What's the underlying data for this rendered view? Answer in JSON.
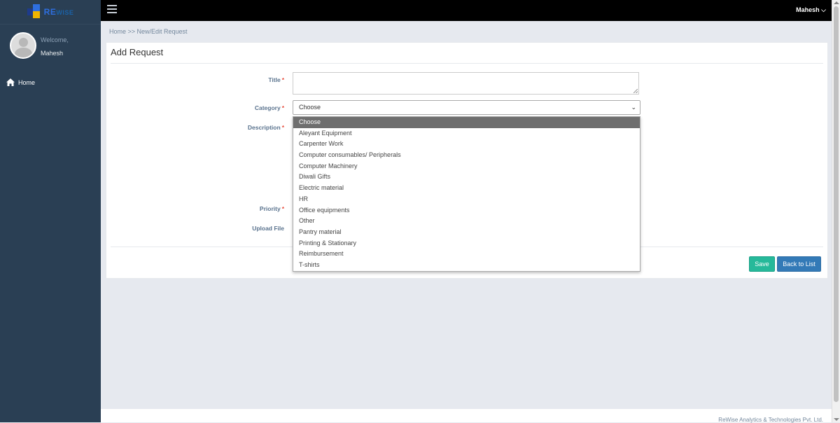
{
  "app": {
    "logo_text": "RE",
    "logo_suffix": "WISE"
  },
  "sidebar": {
    "welcome_label": "Welcome,",
    "user_name": "Mahesh",
    "nav": [
      {
        "label": "Home",
        "icon": "home-icon"
      }
    ]
  },
  "topbar": {
    "user_menu": "Mahesh ⌵"
  },
  "breadcrumb": "Home >> New/Edit Request",
  "form": {
    "heading": "Add Request",
    "title_label": "Title",
    "category_label": "Category",
    "description_label": "Description",
    "priority_label": "Priority",
    "upload_label": "Upload File",
    "required_marker": "*",
    "title_value": "",
    "category_selected": "Choose",
    "category_options": [
      "Choose",
      "Aleyant Equipment",
      "Carpenter Work",
      "Computer consumables/ Peripherals",
      "Computer Machinery",
      "Diwali Gifts",
      "Electric material",
      "HR",
      "Office equipments",
      "Other",
      "Pantry material",
      "Printing & Stationary",
      "Reimbursement",
      "T-shirts"
    ],
    "save_label": "Save",
    "back_label": "Back to List"
  },
  "footer": "ReWise Analytics & Technologies Pvt. Ltd.",
  "colors": {
    "sidebar_bg": "#2a3f54",
    "topbar_bg": "#000000",
    "save_btn": "#26b99a",
    "back_btn": "#337ab7",
    "required": "#e74c3c"
  }
}
